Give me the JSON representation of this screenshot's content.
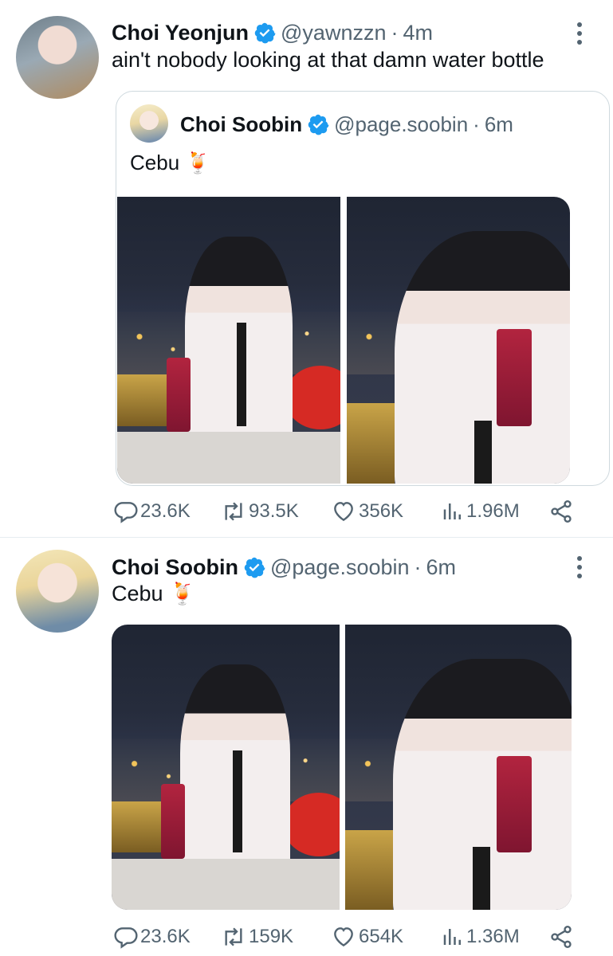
{
  "tweets": [
    {
      "name": "Choi Yeonjun",
      "handle": "@yawnzzn",
      "separator": "·",
      "time": "4m",
      "text": "ain't nobody looking at that damn water bottle",
      "quote": {
        "name": "Choi Soobin",
        "handle": "@page.soobin",
        "separator": "·",
        "time": "6m",
        "text": "Cebu 🍹"
      },
      "stats": {
        "replies": "23.6K",
        "retweets": "93.5K",
        "likes": "356K",
        "views": "1.96M"
      }
    },
    {
      "name": "Choi Soobin",
      "handle": "@page.soobin",
      "separator": "·",
      "time": "6m",
      "text": "Cebu 🍹",
      "stats": {
        "replies": "23.6K",
        "retweets": "159K",
        "likes": "654K",
        "views": "1.36M"
      }
    }
  ],
  "colors": {
    "verified": "#1d9bf0",
    "secondary_text": "#536471",
    "primary_text": "#0f1419",
    "border": "#cfd9de"
  },
  "icons": [
    "reply-icon",
    "retweet-icon",
    "like-icon",
    "views-icon",
    "share-icon",
    "more-icon",
    "verified-icon"
  ]
}
